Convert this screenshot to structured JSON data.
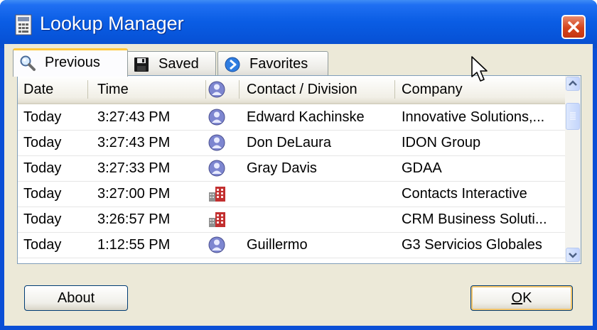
{
  "window": {
    "title": "Lookup Manager"
  },
  "tabs": [
    {
      "label": "Previous",
      "icon": "magnifier-icon",
      "active": true
    },
    {
      "label": "Saved",
      "icon": "floppy-disk-icon",
      "active": false
    },
    {
      "label": "Favorites",
      "icon": "blue-arrow-circle-icon",
      "active": false
    }
  ],
  "grid": {
    "columns": [
      "Date",
      "Time",
      "",
      "Contact / Division",
      "Company"
    ],
    "rows": [
      {
        "date": "Today",
        "time": "3:27:43 PM",
        "type": "contact",
        "contact": "Edward Kachinske",
        "company": "Innovative Solutions,..."
      },
      {
        "date": "Today",
        "time": "3:27:43 PM",
        "type": "contact",
        "contact": "Don DeLaura",
        "company": "IDON Group"
      },
      {
        "date": "Today",
        "time": "3:27:33 PM",
        "type": "contact",
        "contact": "Gray Davis",
        "company": "GDAA"
      },
      {
        "date": "Today",
        "time": "3:27:00 PM",
        "type": "company",
        "contact": "",
        "company": "Contacts Interactive"
      },
      {
        "date": "Today",
        "time": "3:26:57 PM",
        "type": "company",
        "contact": "",
        "company": "CRM Business Soluti..."
      },
      {
        "date": "Today",
        "time": "1:12:55 PM",
        "type": "contact",
        "contact": "Guillermo",
        "company": "G3 Servicios Globales"
      }
    ]
  },
  "buttons": {
    "about": "About",
    "ok_prefix": "O",
    "ok_suffix": "K"
  },
  "colors": {
    "title_bar": "#0a5de4",
    "client_bg": "#ece9d8",
    "close_button": "#d4431b"
  }
}
